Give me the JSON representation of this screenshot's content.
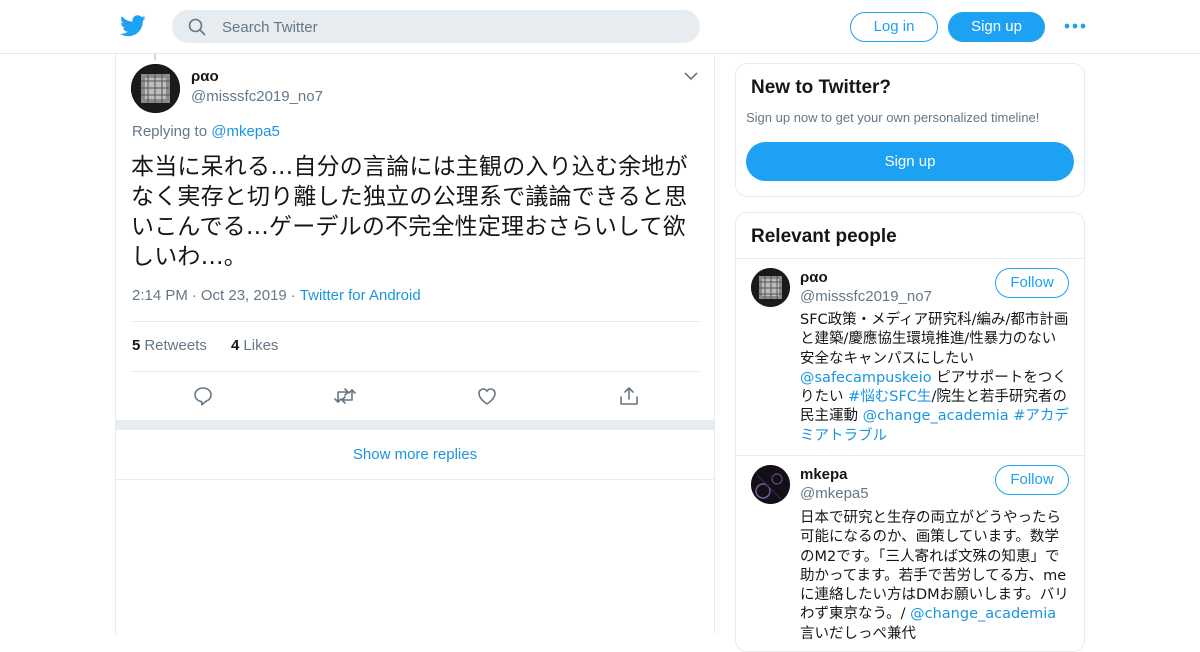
{
  "header": {
    "search_placeholder": "Search Twitter",
    "login_label": "Log in",
    "signup_label": "Sign up",
    "brand_color": "#1da1f2"
  },
  "tweet": {
    "name": "ραο",
    "handle": "@misssfc2019_no7",
    "replying_prefix": "Replying to",
    "replying_to": "@mkepa5",
    "text": "本当に呆れる…自分の言論には主観の入り込む余地がなく実存と切り離した独立の公理系で議論できると思いこんでる…ゲーデルの不完全性定理おさらいして欲しいわ…。",
    "time": "2:14 PM",
    "date": "Oct 23, 2019",
    "source": "Twitter for Android",
    "retweets_count": "5",
    "retweets_label": "Retweets",
    "likes_count": "4",
    "likes_label": "Likes"
  },
  "show_more_label": "Show more replies",
  "sidebar": {
    "new_title": "New to Twitter?",
    "new_subtitle": "Sign up now to get your own personalized timeline!",
    "new_signup_label": "Sign up",
    "relevant_title": "Relevant people",
    "people": [
      {
        "name": "ραο",
        "handle": "@misssfc2019_no7",
        "follow_label": "Follow",
        "bio_1": "SFC政策・メディア研究科/編み/都市計画と建築/慶應協生環境推進/性暴力のない安全なキャンパスにしたい ",
        "bio_link_1": "@safecampuskeio",
        "bio_2": " ピアサポートをつくりたい ",
        "bio_link_2": "#悩むSFC生",
        "bio_3": "/院生と若手研究者の民主運動 ",
        "bio_link_3": "@change_academia",
        "bio_4": " ",
        "bio_link_4": "#アカデミアトラブル"
      },
      {
        "name": "mkepa",
        "handle": "@mkepa5",
        "follow_label": "Follow",
        "bio_1": "日本で研究と生存の両立がどうやったら可能になるのか、画策しています。数学のM2です。「三人寄れば文殊の知恵」で助かってます。若手で苦労してる方、meに連絡したい方はDMお願いします。バリわず東京なう。/ ",
        "bio_link_1": "@change_academia",
        "bio_2": " 言いだしっぺ兼代"
      }
    ]
  }
}
